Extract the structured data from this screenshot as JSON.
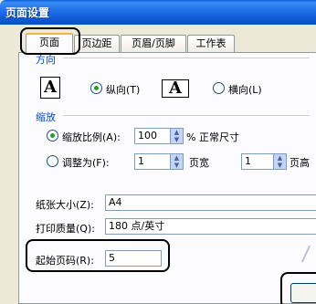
{
  "window": {
    "title": "页面设置"
  },
  "tabs": [
    "页面",
    "页边距",
    "页眉/页脚",
    "工作表"
  ],
  "orientation": {
    "group_label": "方向",
    "portrait_icon": "A",
    "portrait_label": "纵向(T)",
    "landscape_icon": "A",
    "landscape_label": "横向(L)",
    "selected": "portrait"
  },
  "scaling": {
    "group_label": "缩放",
    "adjust_label": "缩放比例(A):",
    "adjust_value": "100",
    "adjust_suffix": "% 正常尺寸",
    "fit_label": "调整为(F):",
    "fit_wide_value": "1",
    "fit_wide_suffix": "页宽",
    "fit_tall_value": "1",
    "fit_tall_suffix": "页高",
    "selected": "adjust"
  },
  "paper_size": {
    "label": "纸张大小(Z):",
    "value": "A4"
  },
  "print_quality": {
    "label": "打印质量(Q):",
    "value": "180 点/英寸"
  },
  "first_page": {
    "label": "起始页码(R):",
    "value": "5"
  },
  "colors": {
    "title_bar": "#0f58d2",
    "selection_radio": "#21a121",
    "group_label": "#0046d5"
  }
}
